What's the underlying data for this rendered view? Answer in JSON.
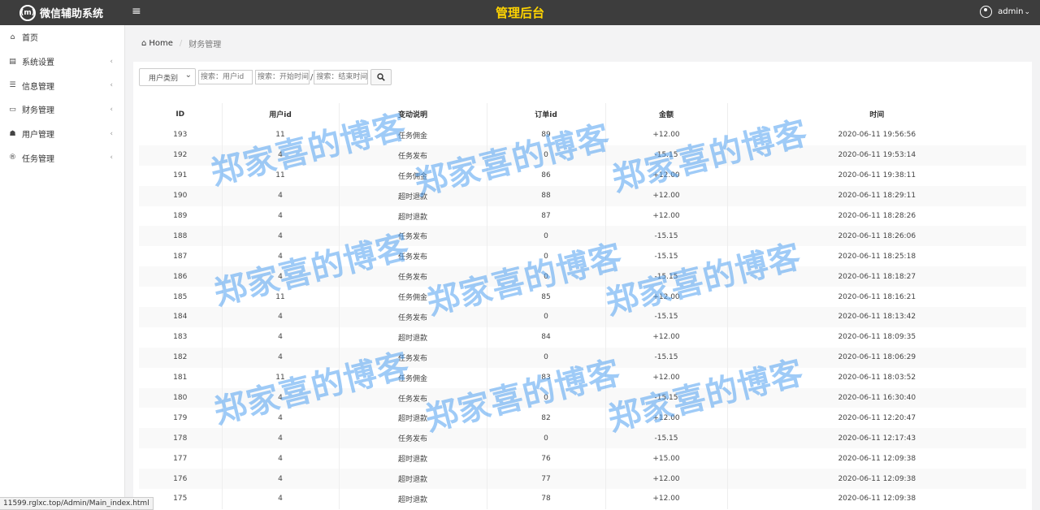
{
  "header": {
    "logo_glyph": "(m)",
    "app_name": "微信辅助系统",
    "menu_glyph": "≡",
    "center_title": "管理后台",
    "user_name": "admin",
    "user_caret": "⌄"
  },
  "sidebar": {
    "items": [
      {
        "label": "首页",
        "icon": "home-icon",
        "glyph": "⌂",
        "arrow": ""
      },
      {
        "label": "系统设置",
        "icon": "settings-icon",
        "glyph": "▤",
        "arrow": "‹"
      },
      {
        "label": "信息管理",
        "icon": "list-icon",
        "glyph": "☰",
        "arrow": "‹"
      },
      {
        "label": "财务管理",
        "icon": "money-icon",
        "glyph": "▭",
        "arrow": "‹"
      },
      {
        "label": "用户管理",
        "icon": "users-icon",
        "glyph": "☗",
        "arrow": "‹"
      },
      {
        "label": "任务管理",
        "icon": "registered-icon",
        "glyph": "®",
        "arrow": "‹"
      }
    ]
  },
  "breadcrumb": {
    "home_glyph": "⌂",
    "home": "Home",
    "separator": "/",
    "current": "财务管理"
  },
  "filters": {
    "type_select": "用户类别",
    "user_id_placeholder": "搜索：用户id",
    "start_placeholder": "搜索：开始时间",
    "end_placeholder": "搜索：结束时间",
    "range_sep": "/"
  },
  "table": {
    "headers": [
      "ID",
      "用户id",
      "变动说明",
      "订单id",
      "金额",
      "时间"
    ],
    "rows": [
      [
        "193",
        "11",
        "任务佣金",
        "89",
        "+12.00",
        "2020-06-11 19:56:56"
      ],
      [
        "192",
        "4",
        "任务发布",
        "0",
        "-15.15",
        "2020-06-11 19:53:14"
      ],
      [
        "191",
        "11",
        "任务佣金",
        "86",
        "+12.00",
        "2020-06-11 19:38:11"
      ],
      [
        "190",
        "4",
        "超时退款",
        "88",
        "+12.00",
        "2020-06-11 18:29:11"
      ],
      [
        "189",
        "4",
        "超时退款",
        "87",
        "+12.00",
        "2020-06-11 18:28:26"
      ],
      [
        "188",
        "4",
        "任务发布",
        "0",
        "-15.15",
        "2020-06-11 18:26:06"
      ],
      [
        "187",
        "4",
        "任务发布",
        "0",
        "-15.15",
        "2020-06-11 18:25:18"
      ],
      [
        "186",
        "4",
        "任务发布",
        "0",
        "-15.15",
        "2020-06-11 18:18:27"
      ],
      [
        "185",
        "11",
        "任务佣金",
        "85",
        "+12.00",
        "2020-06-11 18:16:21"
      ],
      [
        "184",
        "4",
        "任务发布",
        "0",
        "-15.15",
        "2020-06-11 18:13:42"
      ],
      [
        "183",
        "4",
        "超时退款",
        "84",
        "+12.00",
        "2020-06-11 18:09:35"
      ],
      [
        "182",
        "4",
        "任务发布",
        "0",
        "-15.15",
        "2020-06-11 18:06:29"
      ],
      [
        "181",
        "11",
        "任务佣金",
        "83",
        "+12.00",
        "2020-06-11 18:03:52"
      ],
      [
        "180",
        "4",
        "任务发布",
        "0",
        "-15.15",
        "2020-06-11 16:30:40"
      ],
      [
        "179",
        "4",
        "超时退款",
        "82",
        "+12.00",
        "2020-06-11 12:20:47"
      ],
      [
        "178",
        "4",
        "任务发布",
        "0",
        "-15.15",
        "2020-06-11 12:17:43"
      ],
      [
        "177",
        "4",
        "超时退款",
        "76",
        "+15.00",
        "2020-06-11 12:09:38"
      ],
      [
        "176",
        "4",
        "超时退款",
        "77",
        "+12.00",
        "2020-06-11 12:09:38"
      ],
      [
        "175",
        "4",
        "超时退款",
        "78",
        "+12.00",
        "2020-06-11 12:09:38"
      ]
    ]
  },
  "status_url": "11599.rglxc.top/Admin/Main_index.html",
  "watermark": "郑家喜的博客",
  "colors": {
    "topbar": "#3d3d3d",
    "title": "#ffd400",
    "watermark": "#50a0f0"
  }
}
